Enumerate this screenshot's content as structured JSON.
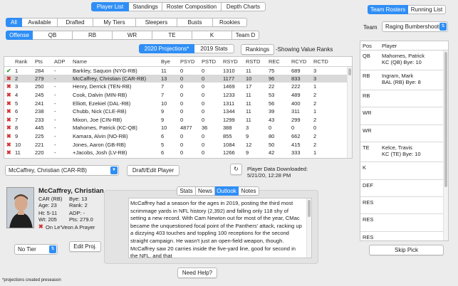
{
  "main_tabs": [
    "Player List",
    "Standings",
    "Roster Composition",
    "Depth Charts"
  ],
  "filter_tabs": [
    "All",
    "Available",
    "Drafted",
    "My Tiers",
    "Sleepers",
    "Busts",
    "Rookies"
  ],
  "position_tabs": [
    "Offense",
    "QB",
    "RB",
    "WR",
    "TE",
    "K",
    "Team D"
  ],
  "projection_tabs": [
    "2020 Projections*",
    "2019 Stats"
  ],
  "rankings_button": "Rankings",
  "rankings_note": "-Showing Value Ranks",
  "table": {
    "columns": [
      "Rank",
      "Pts",
      "ADP",
      "Name",
      "Bye",
      "PSYD",
      "PSTD",
      "RSYD",
      "RSTD",
      "REC",
      "RCYD",
      "RCTD"
    ],
    "rows": [
      {
        "mark": "check",
        "rank": "1",
        "pts": "284",
        "adp": "-",
        "name": "Barkley, Saquon (NYG-RB)",
        "bye": "11",
        "psyd": "0",
        "pstd": "0",
        "rsyd": "1310",
        "rstd": "11",
        "rec": "75",
        "rcyd": "689",
        "rctd": "3"
      },
      {
        "mark": "x",
        "rank": "2",
        "pts": "279",
        "adp": "-",
        "name": "McCaffrey, Christian (CAR-RB)",
        "bye": "13",
        "psyd": "0",
        "pstd": "0",
        "rsyd": "1177",
        "rstd": "10",
        "rec": "96",
        "rcyd": "833",
        "rctd": "3",
        "selected": true
      },
      {
        "mark": "x",
        "rank": "3",
        "pts": "250",
        "adp": "-",
        "name": "Henry, Derrick (TEN-RB)",
        "bye": "7",
        "psyd": "0",
        "pstd": "0",
        "rsyd": "1469",
        "rstd": "17",
        "rec": "22",
        "rcyd": "222",
        "rctd": "1"
      },
      {
        "mark": "x",
        "rank": "4",
        "pts": "245",
        "adp": "-",
        "name": "Cook, Dalvin (MIN-RB)",
        "bye": "7",
        "psyd": "0",
        "pstd": "0",
        "rsyd": "1233",
        "rstd": "11",
        "rec": "53",
        "rcyd": "489",
        "rctd": "2"
      },
      {
        "mark": "x",
        "rank": "5",
        "pts": "241",
        "adp": "-",
        "name": "Elliott, Ezekiel (DAL-RB)",
        "bye": "10",
        "psyd": "0",
        "pstd": "0",
        "rsyd": "1311",
        "rstd": "11",
        "rec": "56",
        "rcyd": "400",
        "rctd": "2"
      },
      {
        "mark": "x",
        "rank": "6",
        "pts": "238",
        "adp": "-",
        "name": "Chubb, Nick (CLE-RB)",
        "bye": "9",
        "psyd": "0",
        "pstd": "0",
        "rsyd": "1344",
        "rstd": "11",
        "rec": "39",
        "rcyd": "311",
        "rctd": "1"
      },
      {
        "mark": "x",
        "rank": "7",
        "pts": "233",
        "adp": "-",
        "name": "Mixon, Joe (CIN-RB)",
        "bye": "9",
        "psyd": "0",
        "pstd": "0",
        "rsyd": "1299",
        "rstd": "11",
        "rec": "43",
        "rcyd": "299",
        "rctd": "2"
      },
      {
        "mark": "x",
        "rank": "8",
        "pts": "445",
        "adp": "-",
        "name": "Mahomes, Patrick (KC-QB)",
        "bye": "10",
        "psyd": "4877",
        "pstd": "36",
        "rsyd": "388",
        "rstd": "3",
        "rec": "0",
        "rcyd": "0",
        "rctd": "0"
      },
      {
        "mark": "x",
        "rank": "9",
        "pts": "225",
        "adp": "-",
        "name": "Kamara, Alvin (NO-RB)",
        "bye": "6",
        "psyd": "0",
        "pstd": "0",
        "rsyd": "855",
        "rstd": "9",
        "rec": "80",
        "rcyd": "662",
        "rctd": "2"
      },
      {
        "mark": "x",
        "rank": "10",
        "pts": "221",
        "adp": "-",
        "name": "Jones, Aaron (GB-RB)",
        "bye": "5",
        "psyd": "0",
        "pstd": "0",
        "rsyd": "1084",
        "rstd": "12",
        "rec": "50",
        "rcyd": "415",
        "rctd": "2"
      },
      {
        "mark": "x",
        "rank": "11",
        "pts": "220",
        "adp": "-",
        "name": "+Jacobs, Josh (LV-RB)",
        "bye": "6",
        "psyd": "0",
        "pstd": "0",
        "rsyd": "1266",
        "rstd": "9",
        "rec": "42",
        "rcyd": "333",
        "rctd": "1"
      }
    ]
  },
  "player_select": "McCaffrey, Christian (CAR-RB)",
  "draft_button": "Draft/Edit Player",
  "downloaded_label": "Player Data Downloaded:",
  "downloaded_date": "5/21/20, 12:28 PM",
  "player": {
    "name": "McCaffrey, Christian",
    "team": "CAR (RB)",
    "age": "Age: 23",
    "height": "Ht: 5-11",
    "weight": "Wt: 205",
    "bye": "Bye: 13",
    "rank": "Rank: 2",
    "adp": "ADP: -",
    "pts": "Pts: 279.0",
    "owner": "On Le'Veon A Prayer"
  },
  "tier_select": "No Tier",
  "edit_proj_button": "Edit Proj.",
  "detail_tabs": [
    "Stats",
    "News",
    "Outlook",
    "Notes"
  ],
  "outlook_text": "McCaffrey had a season for the ages in 2019, posting the third most scrimmage yards in NFL history (2,392) and falling only 118 shy of setting a new record. With Cam Newton out for most of the year, CMac became the unquestioned focal point of the Panthers' attack, racking up a dizzying 403 touches and toppling 100 receptions for the second straight campaign. He wasn't just an open-field weapon, though. McCaffrey saw 20 carries inside the five-yard line, good for second in the NFL, and that",
  "help_button": "Need Help?",
  "footnote": "*projections created preseason",
  "right": {
    "tabs": [
      "Team Rosters",
      "Running List"
    ],
    "team_label": "Team",
    "team_select": "Raging Bumbershoots",
    "columns": [
      "Pos",
      "Player"
    ],
    "rows": [
      {
        "pos": "QB",
        "player": "Mahomes, Patrick",
        "sub": "KC (QB)  Bye: 10"
      },
      {
        "pos": "RB",
        "player": "Ingram, Mark",
        "sub": "BAL (RB)  Bye: 8"
      },
      {
        "pos": "RB",
        "player": "",
        "sub": ""
      },
      {
        "pos": "WR",
        "player": "",
        "sub": ""
      },
      {
        "pos": "WR",
        "player": "",
        "sub": ""
      },
      {
        "pos": "TE",
        "player": "Kelce, Travis",
        "sub": "KC (TE)  Bye: 10"
      },
      {
        "pos": "K",
        "player": "",
        "sub": ""
      },
      {
        "pos": "DEF",
        "player": "",
        "sub": ""
      },
      {
        "pos": "RES",
        "player": "",
        "sub": ""
      },
      {
        "pos": "RES",
        "player": "",
        "sub": ""
      },
      {
        "pos": "RES",
        "player": "",
        "sub": ""
      }
    ],
    "skip_button": "Skip Pick"
  }
}
